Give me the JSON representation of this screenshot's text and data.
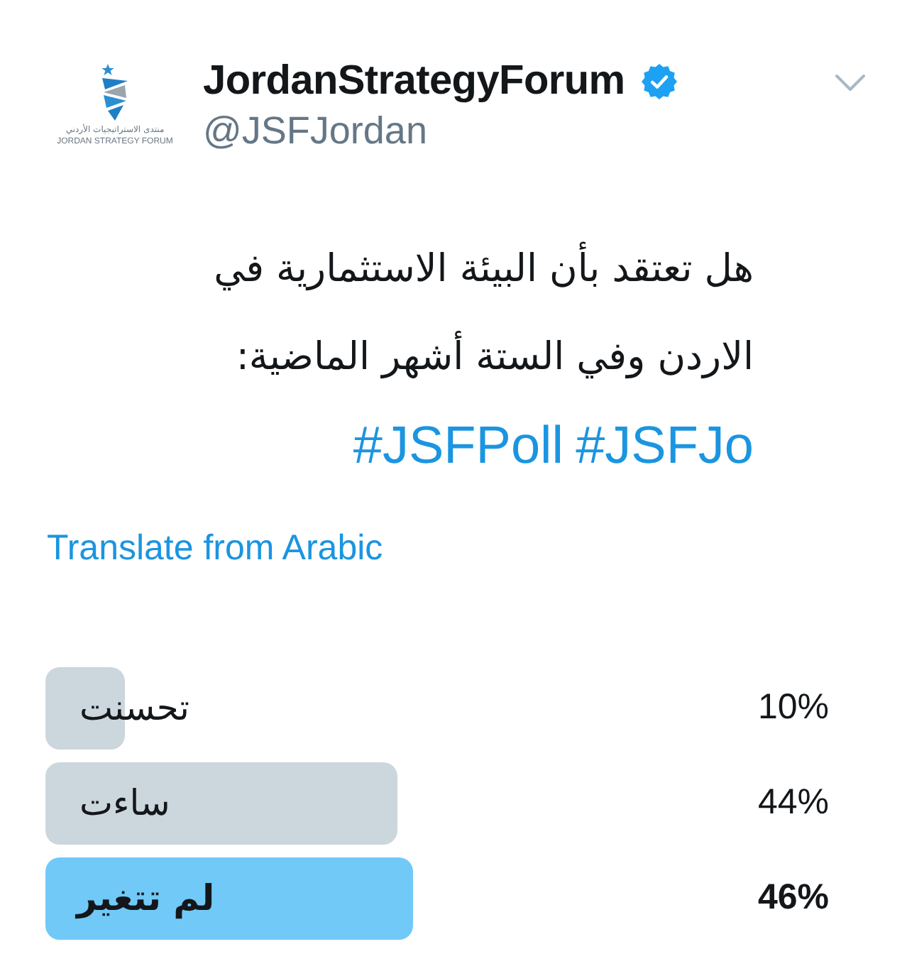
{
  "account": {
    "logo": {
      "text_ar": "منتدى الاستراتيجيات الأردني",
      "text_en": "JORDAN STRATEGY FORUM"
    },
    "name": "JordanStrategyForum",
    "verified": true,
    "handle": "@JSFJordan"
  },
  "tweet": {
    "text_lines": [
      "هل تعتقد بأن البيئة الاستثمارية في",
      "الاردن وفي الستة أشهر الماضية:"
    ],
    "hashtags": [
      "#JSFJo",
      "#JSFPoll"
    ],
    "translate_link": "Translate from Arabic"
  },
  "poll": {
    "options": [
      {
        "label": "تحسنت",
        "percent": "10%",
        "level": 0.1,
        "winner": false
      },
      {
        "label": "ساءت",
        "percent": "44%",
        "level": 0.44,
        "winner": false
      },
      {
        "label": "لم تتغير",
        "percent": "46%",
        "level": 0.46,
        "winner": true
      }
    ]
  }
}
